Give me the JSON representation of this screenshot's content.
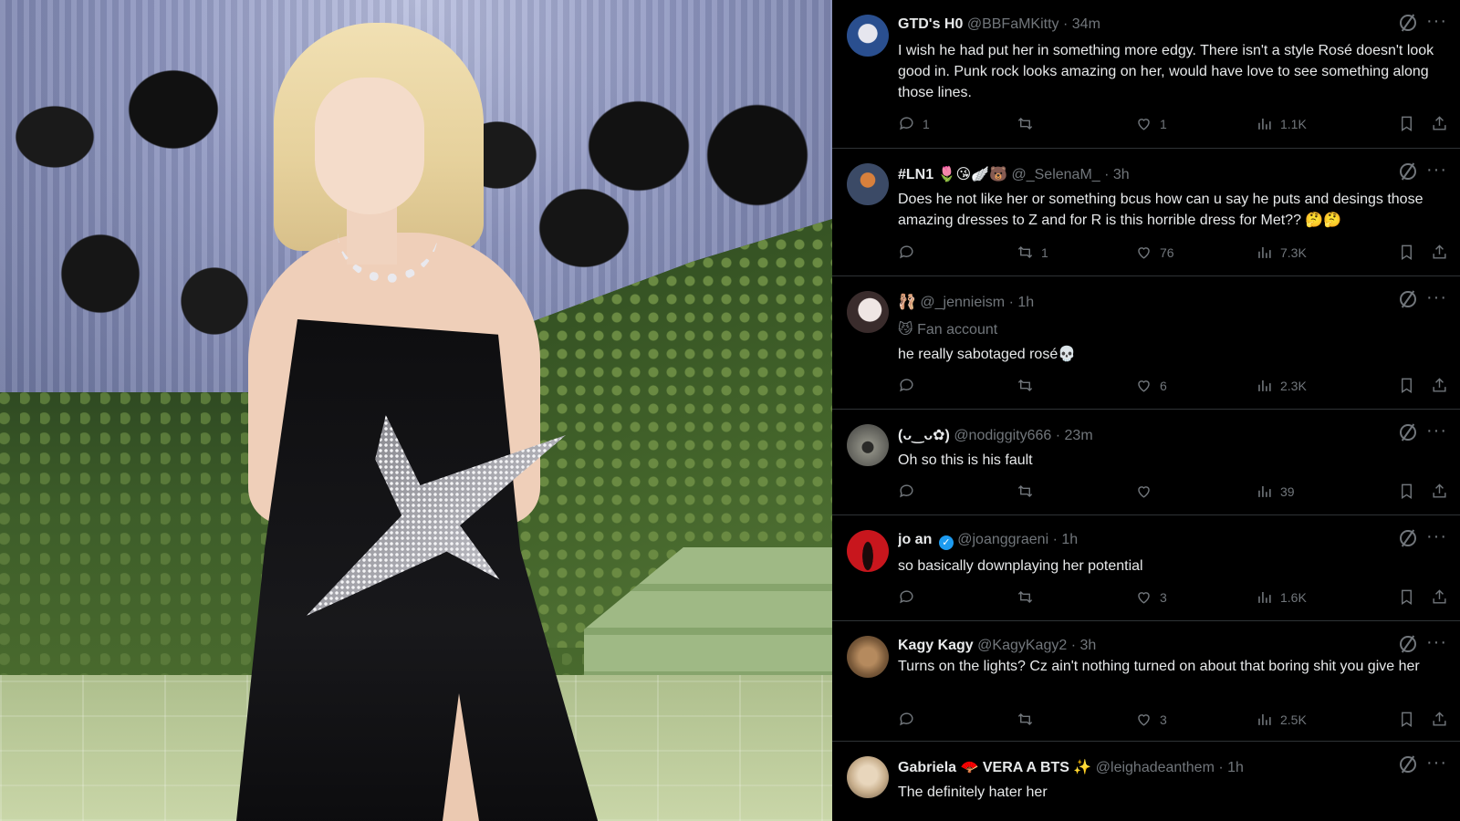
{
  "tweets": [
    {
      "name": "GTD's H0",
      "emojis": "",
      "handle": "@BBFaMKitty",
      "time": "34m",
      "label": "",
      "text": "I wish he had put her in something more edgy. There isn't a style Rosé doesn't look good in. Punk rock looks amazing on her, would have love to see something along those lines.",
      "replies": "1",
      "reposts": "",
      "likes": "1",
      "views": "1.1K",
      "avatar_color": "#2a4f8f"
    },
    {
      "name": "#LN1",
      "emojis": "🌷😘🪽🐻",
      "handle": "@_SelenaM_",
      "time": "3h",
      "label": "",
      "text": "Does he not like her or something bcus how can u say he puts and desings those amazing dresses to Z and for R is this horrible dress for Met?? 🤔🤔",
      "replies": "",
      "reposts": "1",
      "likes": "76",
      "views": "7.3K",
      "avatar_color": "#3b4a66"
    },
    {
      "name": "🩰",
      "emojis": "",
      "handle": "@_jennieism",
      "time": "1h",
      "label": "😼 Fan account",
      "text": "he really sabotaged rosé💀",
      "replies": "",
      "reposts": "",
      "likes": "6",
      "views": "2.3K",
      "avatar_color": "#d9cfcf"
    },
    {
      "name": "(ᴗ‿ᴗ✿)",
      "emojis": "",
      "handle": "@nodiggity666",
      "time": "23m",
      "label": "",
      "text": "Oh so this is his fault",
      "replies": "",
      "reposts": "",
      "likes": "",
      "views": "39",
      "avatar_color": "#6b6b66"
    },
    {
      "name": "jo an",
      "emojis": "",
      "handle": "@joanggraeni",
      "time": "1h",
      "label": "",
      "text": "so basically downplaying her potential",
      "replies": "",
      "reposts": "",
      "likes": "3",
      "views": "1.6K",
      "avatar_color": "#c8161d"
    },
    {
      "name": "Kagy Kagy",
      "emojis": "",
      "handle": "@KagyKagy2",
      "time": "3h",
      "label": "",
      "text": "Turns on the lights? Cz ain't nothing turned on about that boring shit you give her",
      "replies": "",
      "reposts": "",
      "likes": "3",
      "views": "2.5K",
      "avatar_color": "#7a5a3a"
    },
    {
      "name": "Gabriela 🪭 VERA A BTS ✨",
      "emojis": "",
      "handle": "@leighadeanthem",
      "time": "1h",
      "label": "",
      "text": "The definitely hater her",
      "replies": "",
      "reposts": "",
      "likes": "",
      "views": "",
      "avatar_color": "#c9b08e"
    }
  ],
  "icons": {
    "reply": "reply-icon",
    "repost": "repost-icon",
    "like": "heart-icon",
    "views": "views-icon",
    "bookmark": "bookmark-icon",
    "share": "share-icon",
    "grok": "grok-icon",
    "more": "more-icon",
    "verified": "verified-badge-icon"
  }
}
